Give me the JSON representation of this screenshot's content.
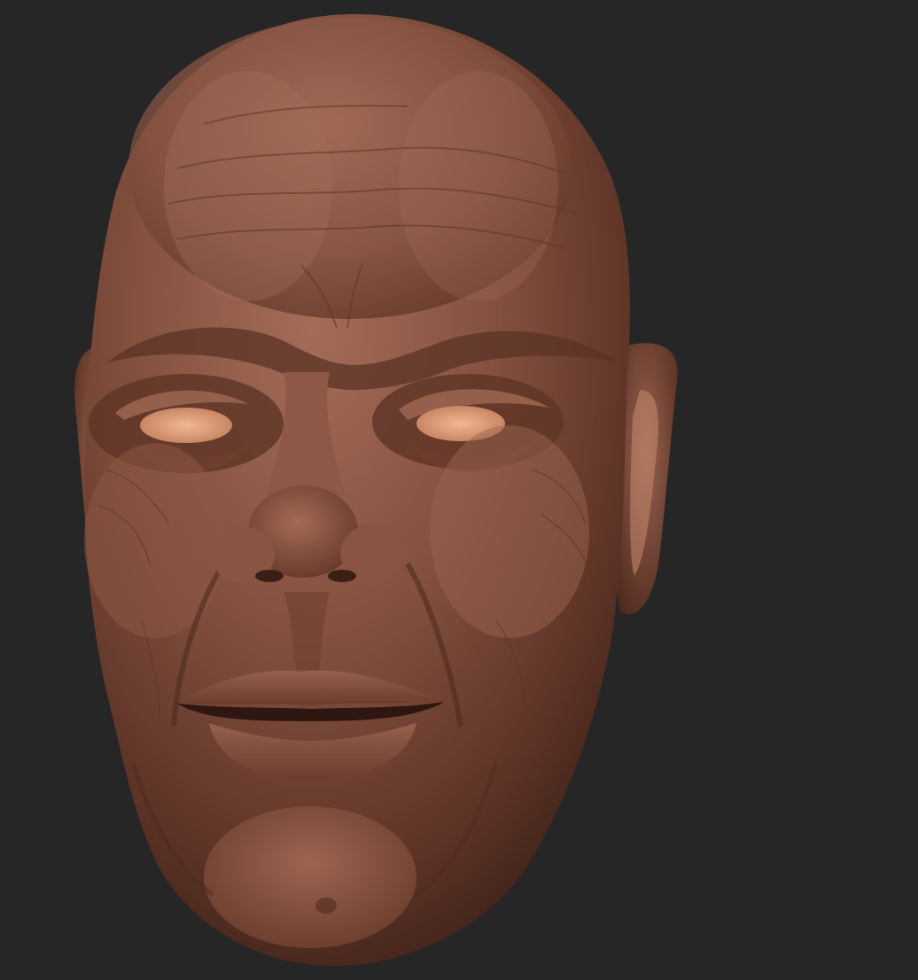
{
  "scene": {
    "subject": "sculpted-head",
    "background_color": "#262626",
    "clay_color": "#7a4a3a",
    "clay_highlight": "#a8705c",
    "clay_shadow": "#3d2219",
    "eye_color": "#e0a07e"
  }
}
